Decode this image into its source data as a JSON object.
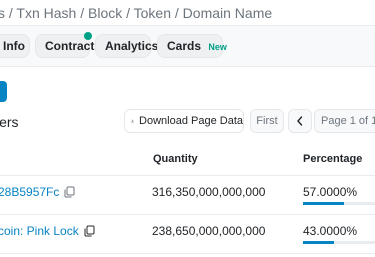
{
  "search": {
    "placeholder": "s / Txn Hash / Block / Token / Domain Name"
  },
  "tabs": [
    {
      "label": "Info"
    },
    {
      "label": "Contract"
    },
    {
      "label": "Analytics"
    },
    {
      "label": "Cards",
      "badge": "New"
    }
  ],
  "section": {
    "title": "lers"
  },
  "toolbar": {
    "download_label": "Download Page Data",
    "first_label": "First",
    "prev_icon": "chevron-left-icon",
    "page_indicator": "Page 1 of 1"
  },
  "table": {
    "headers": {
      "quantity": "Quantity",
      "percentage": "Percentage"
    },
    "rows": [
      {
        "address": "28B5957Fc",
        "quantity": "316,350,000,000,000",
        "percentage": "57.0000%",
        "percent_value": 57.0
      },
      {
        "address": "coin: Pink Lock",
        "quantity": "238,650,000,000,000",
        "percentage": "43.0000%",
        "percent_value": 43.0
      }
    ]
  },
  "colors": {
    "accent": "#0784c3",
    "badge": "#00a186"
  }
}
